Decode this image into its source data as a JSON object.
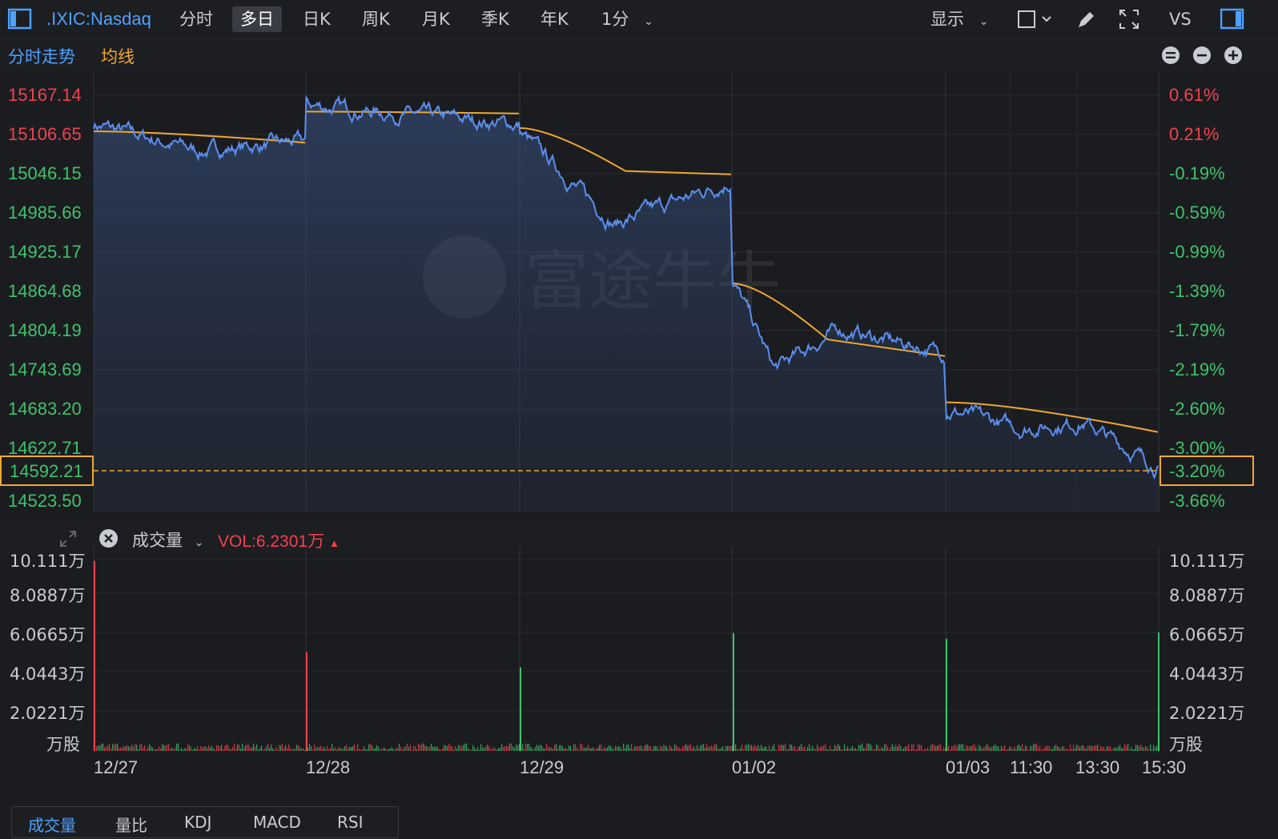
{
  "toolbar": {
    "symbol": ".IXIC:Nasdaq",
    "periods": [
      "分时",
      "多日",
      "日K",
      "周K",
      "月K",
      "季K",
      "年K"
    ],
    "active_period": "多日",
    "interval": "1分",
    "display_label": "显示",
    "vs_label": "VS"
  },
  "legend": {
    "line_label": "分时走势",
    "avg_label": "均线"
  },
  "price_axis": {
    "left": [
      "15167.14",
      "15106.65",
      "15046.15",
      "14985.66",
      "14925.17",
      "14864.68",
      "14804.19",
      "14743.69",
      "14683.20",
      "14622.71",
      "14523.50"
    ],
    "right": [
      "0.61%",
      "0.21%",
      "-0.19%",
      "-0.59%",
      "-0.99%",
      "-1.39%",
      "-1.79%",
      "-2.19%",
      "-2.60%",
      "-3.00%",
      "-3.66%"
    ],
    "current_price": "14592.21",
    "current_pct": "-3.20%",
    "colors": {
      "up": "#f2424e",
      "down": "#3fc36b",
      "line": "#5b8ff0",
      "avg": "#f0a830",
      "highlight": "#f0a830"
    }
  },
  "volume": {
    "header_label": "成交量",
    "vol_value": "VOL:6.2301万",
    "axis": [
      "10.111万",
      "8.0887万",
      "6.0665万",
      "4.0443万",
      "2.0221万"
    ],
    "unit": "万股"
  },
  "x_axis": [
    "12/27",
    "12/28",
    "12/29",
    "01/02",
    "01/03",
    "11:30",
    "13:30",
    "15:30"
  ],
  "indicator_tabs": [
    "成交量",
    "量比",
    "KDJ",
    "MACD",
    "RSI"
  ],
  "active_indicator": "成交量",
  "watermark": "富途牛牛",
  "chart_data": {
    "type": "line",
    "sessions": [
      "12/27",
      "12/28",
      "12/29",
      "01/02",
      "01/03"
    ],
    "ylim": [
      14523.5,
      15191
    ],
    "series": [
      {
        "name": "分时走势",
        "x": [
          "12/27 open",
          "12/27 mid",
          "12/27 close",
          "12/28 open",
          "12/28 mid",
          "12/28 close",
          "12/29 open",
          "12/29 low",
          "12/29 close",
          "01/02 open",
          "01/02 low",
          "01/02 mid",
          "01/02 close",
          "01/03 open",
          "01/03 11:30",
          "01/03 13:30",
          "01/03 15:30"
        ],
        "values": [
          15111,
          15070,
          15085,
          15140,
          15125,
          15110,
          15100,
          14960,
          15025,
          14880,
          14740,
          14800,
          14765,
          14680,
          14650,
          14660,
          14592.21
        ]
      },
      {
        "name": "均线",
        "x": [
          "12/27 open",
          "12/27 close",
          "12/28 open",
          "12/28 close",
          "12/29 open",
          "12/29 mid",
          "12/29 close",
          "01/02 open",
          "01/02 mid",
          "01/02 close",
          "01/03 open",
          "01/03 close"
        ],
        "values": [
          15100,
          15083,
          15130,
          15127,
          15105,
          15040,
          15035,
          14870,
          14785,
          14760,
          14690,
          14645
        ]
      }
    ],
    "volume_series": {
      "ylim": [
        0,
        10.111
      ],
      "unit": "万",
      "spikes": [
        {
          "session": "12/27",
          "value": 10.0,
          "color": "up"
        },
        {
          "session": "12/28",
          "value": 5.2,
          "color": "up"
        },
        {
          "session": "12/29",
          "value": 4.4,
          "color": "down"
        },
        {
          "session": "01/02",
          "value": 6.2,
          "color": "down"
        },
        {
          "session": "01/03",
          "value": 5.9,
          "color": "down"
        },
        {
          "session": "01/03 close",
          "value": 6.2301,
          "color": "down"
        }
      ]
    }
  }
}
